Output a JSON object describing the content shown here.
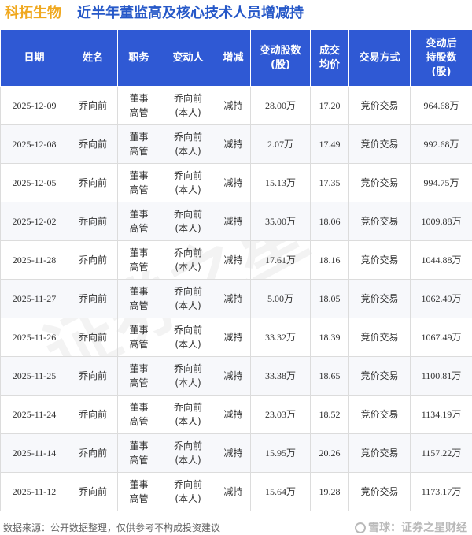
{
  "title": {
    "company": "科拓生物",
    "text": "近半年董监高及核心技术人员增减持"
  },
  "columns": [
    "日期",
    "姓名",
    "职务",
    "变动人",
    "增减",
    "变动股数\n(股)",
    "成交\n均价",
    "交易方式",
    "变动后\n持股数\n(股)"
  ],
  "rows": [
    {
      "date": "2025-12-09",
      "name": "乔向前",
      "role": "董事\n高管",
      "person": "乔向前\n(本人)",
      "change": "减持",
      "shares": "28.00万",
      "price": "17.20",
      "method": "竞价交易",
      "after": "964.68万"
    },
    {
      "date": "2025-12-08",
      "name": "乔向前",
      "role": "董事\n高管",
      "person": "乔向前\n(本人)",
      "change": "减持",
      "shares": "2.07万",
      "price": "17.49",
      "method": "竞价交易",
      "after": "992.68万"
    },
    {
      "date": "2025-12-05",
      "name": "乔向前",
      "role": "董事\n高管",
      "person": "乔向前\n(本人)",
      "change": "减持",
      "shares": "15.13万",
      "price": "17.35",
      "method": "竞价交易",
      "after": "994.75万"
    },
    {
      "date": "2025-12-02",
      "name": "乔向前",
      "role": "董事\n高管",
      "person": "乔向前\n(本人)",
      "change": "减持",
      "shares": "35.00万",
      "price": "18.06",
      "method": "竞价交易",
      "after": "1009.88万"
    },
    {
      "date": "2025-11-28",
      "name": "乔向前",
      "role": "董事\n高管",
      "person": "乔向前\n(本人)",
      "change": "减持",
      "shares": "17.61万",
      "price": "18.16",
      "method": "竞价交易",
      "after": "1044.88万"
    },
    {
      "date": "2025-11-27",
      "name": "乔向前",
      "role": "董事\n高管",
      "person": "乔向前\n(本人)",
      "change": "减持",
      "shares": "5.00万",
      "price": "18.05",
      "method": "竞价交易",
      "after": "1062.49万"
    },
    {
      "date": "2025-11-26",
      "name": "乔向前",
      "role": "董事\n高管",
      "person": "乔向前\n(本人)",
      "change": "减持",
      "shares": "33.32万",
      "price": "18.39",
      "method": "竞价交易",
      "after": "1067.49万"
    },
    {
      "date": "2025-11-25",
      "name": "乔向前",
      "role": "董事\n高管",
      "person": "乔向前\n(本人)",
      "change": "减持",
      "shares": "33.38万",
      "price": "18.65",
      "method": "竞价交易",
      "after": "1100.81万"
    },
    {
      "date": "2025-11-24",
      "name": "乔向前",
      "role": "董事\n高管",
      "person": "乔向前\n(本人)",
      "change": "减持",
      "shares": "23.03万",
      "price": "18.52",
      "method": "竞价交易",
      "after": "1134.19万"
    },
    {
      "date": "2025-11-14",
      "name": "乔向前",
      "role": "董事\n高管",
      "person": "乔向前\n(本人)",
      "change": "减持",
      "shares": "15.95万",
      "price": "20.26",
      "method": "竞价交易",
      "after": "1157.22万"
    },
    {
      "date": "2025-11-12",
      "name": "乔向前",
      "role": "董事\n高管",
      "person": "乔向前\n(本人)",
      "change": "减持",
      "shares": "15.64万",
      "price": "19.28",
      "method": "竞价交易",
      "after": "1173.17万"
    }
  ],
  "watermark": "证券之星",
  "footer": {
    "source": "数据来源：公开数据整理，仅供参考不构成投资建议",
    "brand": "雪球：证券之星财经",
    "brand_icon": "snowball-icon"
  },
  "colors": {
    "header_bg": "#2f59d4",
    "title_company": "#f0a81e",
    "title_text": "#2658c8",
    "change_text": "#3ca02d"
  }
}
